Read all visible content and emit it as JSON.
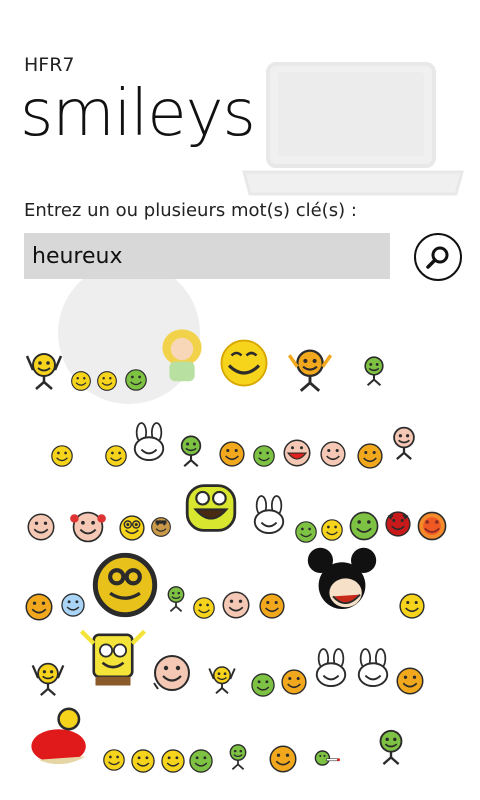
{
  "app": {
    "name": "HFR7"
  },
  "page": {
    "title": "smileys"
  },
  "search": {
    "label": "Entrez un ou plusieurs mot(s) clé(s) :",
    "value": "heureux"
  },
  "icons": {
    "search": "search-magnifier-icon",
    "background": "laptop-icon"
  },
  "colors": {
    "input_bg": "#d8d8d8",
    "smiley_yellow": "#f7d41c",
    "smiley_pink": "#f4c8b4",
    "smiley_outline": "#2b2b2b"
  },
  "smileys": [
    {
      "kind": "arms-up"
    },
    {
      "kind": "face"
    },
    {
      "kind": "face"
    },
    {
      "kind": "face-green"
    },
    {
      "kind": "girl"
    },
    {
      "kind": "big-grin"
    },
    {
      "kind": "arms-up-orange"
    },
    {
      "kind": "dancing"
    },
    {
      "kind": "face"
    },
    {
      "kind": "face"
    },
    {
      "kind": "bunny"
    },
    {
      "kind": "dancing"
    },
    {
      "kind": "face-orange"
    },
    {
      "kind": "face-green"
    },
    {
      "kind": "pink-red"
    },
    {
      "kind": "pink"
    },
    {
      "kind": "face-orange"
    },
    {
      "kind": "pink-legs"
    },
    {
      "kind": "pink"
    },
    {
      "kind": "pigtails"
    },
    {
      "kind": "face-glasses"
    },
    {
      "kind": "face-dark"
    },
    {
      "kind": "big-green"
    },
    {
      "kind": "bunny"
    },
    {
      "kind": "face-green"
    },
    {
      "kind": "face"
    },
    {
      "kind": "face-green"
    },
    {
      "kind": "devil"
    },
    {
      "kind": "face-red"
    },
    {
      "kind": "face-orange"
    },
    {
      "kind": "face-blue"
    },
    {
      "kind": "big-yellow"
    },
    {
      "kind": "dancing"
    },
    {
      "kind": "face"
    },
    {
      "kind": "pink"
    },
    {
      "kind": "face-orange"
    },
    {
      "kind": "mickey"
    },
    {
      "kind": "face"
    },
    {
      "kind": "arms-up"
    },
    {
      "kind": "sponge"
    },
    {
      "kind": "pink-wave"
    },
    {
      "kind": "arms-up"
    },
    {
      "kind": "face-green"
    },
    {
      "kind": "face-orange"
    },
    {
      "kind": "bunny"
    },
    {
      "kind": "bunny"
    },
    {
      "kind": "face-orange"
    },
    {
      "kind": "red-pillow"
    },
    {
      "kind": "face"
    },
    {
      "kind": "face"
    },
    {
      "kind": "face"
    },
    {
      "kind": "face-green"
    },
    {
      "kind": "dancing"
    },
    {
      "kind": "face-orange"
    },
    {
      "kind": "smoker"
    },
    {
      "kind": "dancing"
    }
  ]
}
